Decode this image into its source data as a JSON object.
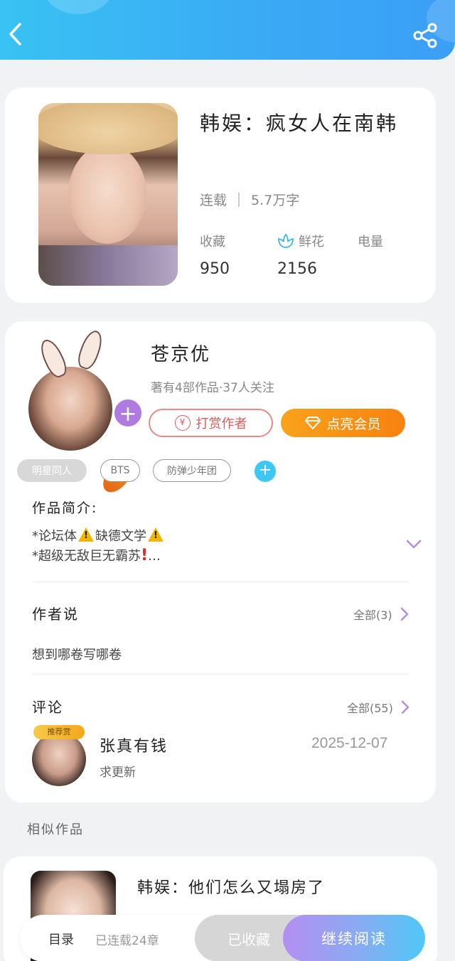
{
  "header": {
    "back_icon": "chevron-left-icon",
    "share_icon": "share-icon",
    "colors": {
      "start": "#39c2f3",
      "end": "#3b9ff6"
    }
  },
  "book": {
    "title": "韩娱：疯女人在南韩",
    "status": "连载",
    "word_count": "5.7万字",
    "stats": [
      {
        "label": "收藏",
        "value": "950"
      },
      {
        "label": "鲜花",
        "value": "2156",
        "icon": "flower-icon"
      },
      {
        "label": "电量",
        "value": ""
      }
    ]
  },
  "author": {
    "name": "苍京优",
    "stats": "著有4部作品·37人关注",
    "reward_label": "打赏作者",
    "vip_label": "点亮会员",
    "tags": [
      "明星同人",
      "BTS",
      "防弹少年团"
    ]
  },
  "intro": {
    "title": "作品简介:",
    "line1_prefix": "*论坛体",
    "line1_middle": "缺德文学",
    "line2_prefix": "*超级无敌巨无霸苏",
    "line2_suffix": "…"
  },
  "author_says": {
    "title": "作者说",
    "more": "全部(3)",
    "text": "想到哪卷写哪卷"
  },
  "comments": {
    "title": "评论",
    "more": "全部(55)",
    "badge": "推荐赏",
    "items": [
      {
        "user": "张真有钱",
        "date": "2025-12-07",
        "text": "求更新"
      }
    ]
  },
  "similar": {
    "title": "相似作品",
    "items": [
      {
        "title": "韩娱：他们怎么又塌房了",
        "desc": ""
      }
    ]
  },
  "bottom_bar": {
    "toc": "目录",
    "chapters": "已连载24章",
    "collected": "已收藏",
    "read": "继续阅读"
  }
}
